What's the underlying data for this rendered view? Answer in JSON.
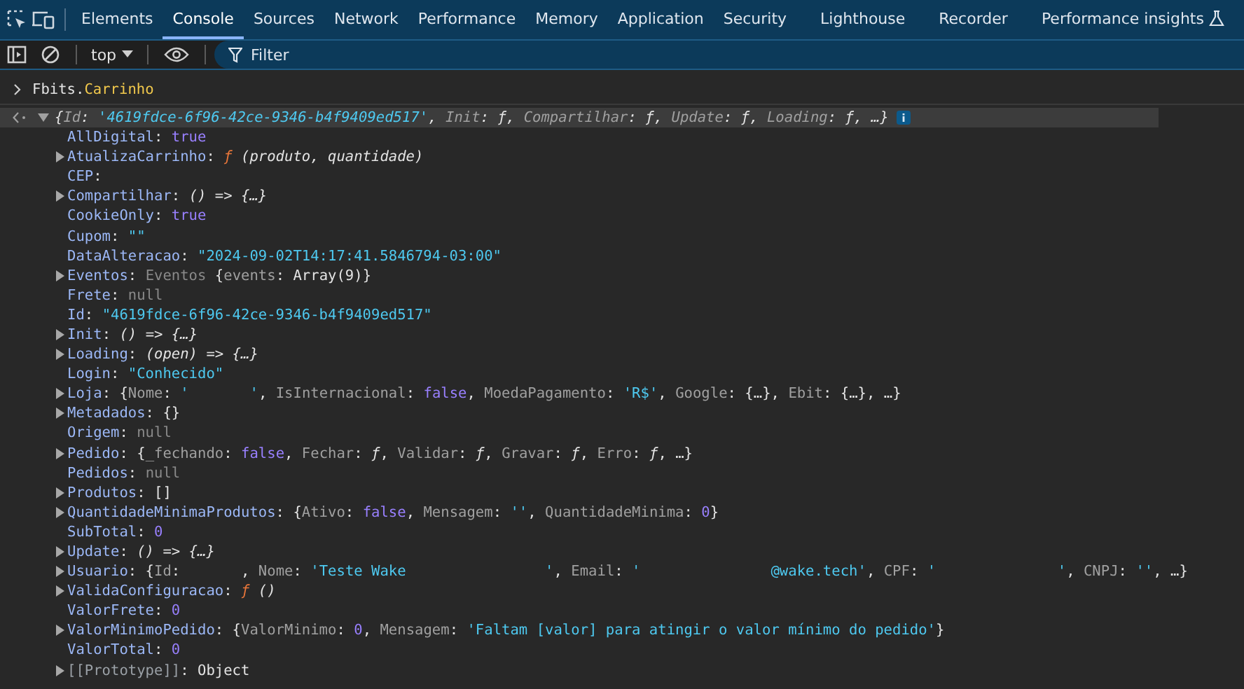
{
  "tabs": [
    {
      "label": "Elements",
      "selected": false
    },
    {
      "label": "Console",
      "selected": true
    },
    {
      "label": "Sources",
      "selected": false
    },
    {
      "label": "Network",
      "selected": false
    },
    {
      "label": "Performance",
      "selected": false
    },
    {
      "label": "Memory",
      "selected": false
    },
    {
      "label": "Application",
      "selected": false
    },
    {
      "label": "Security",
      "selected": false
    },
    {
      "label": "Lighthouse",
      "selected": false
    },
    {
      "label": "Recorder",
      "selected": false
    },
    {
      "label": "Performance insights",
      "selected": false,
      "experimental": true
    }
  ],
  "toolbar": {
    "context": "top",
    "filter": {
      "placeholder": "Filter"
    }
  },
  "console": {
    "input": [
      {
        "kind": "plain",
        "text": "Fbits."
      },
      {
        "kind": "prop",
        "text": "Carrinho"
      }
    ],
    "result": [
      {
        "kind": "punct",
        "text": "{"
      },
      {
        "kind": "pkey",
        "text": "Id"
      },
      {
        "kind": "punct",
        "text": ": "
      },
      {
        "kind": "str",
        "text": "'4619fdce-6f96-42ce-9346-b4f9409ed517'"
      },
      {
        "kind": "punct",
        "text": ", "
      },
      {
        "kind": "pkey",
        "text": "Init"
      },
      {
        "kind": "punct",
        "text": ": "
      },
      {
        "kind": "code",
        "text": "ƒ"
      },
      {
        "kind": "punct",
        "text": ", "
      },
      {
        "kind": "pkey",
        "text": "Compartilhar"
      },
      {
        "kind": "punct",
        "text": ": "
      },
      {
        "kind": "code",
        "text": "ƒ"
      },
      {
        "kind": "punct",
        "text": ", "
      },
      {
        "kind": "pkey",
        "text": "Update"
      },
      {
        "kind": "punct",
        "text": ": "
      },
      {
        "kind": "code",
        "text": "ƒ"
      },
      {
        "kind": "punct",
        "text": ", "
      },
      {
        "kind": "pkey",
        "text": "Loading"
      },
      {
        "kind": "punct",
        "text": ": "
      },
      {
        "kind": "code",
        "text": "ƒ"
      },
      {
        "kind": "punct",
        "text": ", …}"
      }
    ],
    "properties": [
      {
        "expandable": false,
        "segments": [
          {
            "kind": "key",
            "text": "AllDigital"
          },
          {
            "kind": "punct",
            "text": ": "
          },
          {
            "kind": "kw",
            "text": "true"
          }
        ]
      },
      {
        "expandable": true,
        "segments": [
          {
            "kind": "key",
            "text": "AtualizaCarrinho"
          },
          {
            "kind": "punct",
            "text": ": "
          },
          {
            "kind": "fn",
            "text": "ƒ"
          },
          {
            "kind": "code",
            "text": " (produto, quantidade)"
          }
        ]
      },
      {
        "expandable": false,
        "segments": [
          {
            "kind": "key",
            "text": "CEP"
          },
          {
            "kind": "punct",
            "text": ":"
          }
        ]
      },
      {
        "expandable": true,
        "segments": [
          {
            "kind": "key",
            "text": "Compartilhar"
          },
          {
            "kind": "punct",
            "text": ": "
          },
          {
            "kind": "code",
            "text": "() => {…}"
          }
        ]
      },
      {
        "expandable": false,
        "segments": [
          {
            "kind": "key",
            "text": "CookieOnly"
          },
          {
            "kind": "punct",
            "text": ": "
          },
          {
            "kind": "kw",
            "text": "true"
          }
        ]
      },
      {
        "expandable": false,
        "segments": [
          {
            "kind": "key",
            "text": "Cupom"
          },
          {
            "kind": "punct",
            "text": ": "
          },
          {
            "kind": "str",
            "text": "\"\""
          }
        ]
      },
      {
        "expandable": false,
        "segments": [
          {
            "kind": "key",
            "text": "DataAlteracao"
          },
          {
            "kind": "punct",
            "text": ": "
          },
          {
            "kind": "str",
            "text": "\"2024-09-02T14:17:41.5846794-03:00\""
          }
        ]
      },
      {
        "expandable": true,
        "segments": [
          {
            "kind": "key",
            "text": "Eventos"
          },
          {
            "kind": "punct",
            "text": ": "
          },
          {
            "kind": "null",
            "text": "Eventos "
          },
          {
            "kind": "punct",
            "text": "{"
          },
          {
            "kind": "pkey",
            "text": "events"
          },
          {
            "kind": "punct",
            "text": ": Array(9)}"
          }
        ]
      },
      {
        "expandable": false,
        "segments": [
          {
            "kind": "key",
            "text": "Frete"
          },
          {
            "kind": "punct",
            "text": ": "
          },
          {
            "kind": "null",
            "text": "null"
          }
        ]
      },
      {
        "expandable": false,
        "segments": [
          {
            "kind": "key",
            "text": "Id"
          },
          {
            "kind": "punct",
            "text": ": "
          },
          {
            "kind": "str",
            "text": "\"4619fdce-6f96-42ce-9346-b4f9409ed517\""
          }
        ]
      },
      {
        "expandable": true,
        "segments": [
          {
            "kind": "key",
            "text": "Init"
          },
          {
            "kind": "punct",
            "text": ": "
          },
          {
            "kind": "code",
            "text": "() => {…}"
          }
        ]
      },
      {
        "expandable": true,
        "segments": [
          {
            "kind": "key",
            "text": "Loading"
          },
          {
            "kind": "punct",
            "text": ": "
          },
          {
            "kind": "code",
            "text": "(open) => {…}"
          }
        ]
      },
      {
        "expandable": false,
        "segments": [
          {
            "kind": "key",
            "text": "Login"
          },
          {
            "kind": "punct",
            "text": ": "
          },
          {
            "kind": "str",
            "text": "\"Conhecido\""
          }
        ]
      },
      {
        "expandable": true,
        "segments": [
          {
            "kind": "key",
            "text": "Loja"
          },
          {
            "kind": "punct",
            "text": ": {"
          },
          {
            "kind": "pkey",
            "text": "Nome"
          },
          {
            "kind": "punct",
            "text": ": "
          },
          {
            "kind": "str",
            "text": "'       '"
          },
          {
            "kind": "punct",
            "text": ", "
          },
          {
            "kind": "pkey",
            "text": "IsInternacional"
          },
          {
            "kind": "punct",
            "text": ": "
          },
          {
            "kind": "kw",
            "text": "false"
          },
          {
            "kind": "punct",
            "text": ", "
          },
          {
            "kind": "pkey",
            "text": "MoedaPagamento"
          },
          {
            "kind": "punct",
            "text": ": "
          },
          {
            "kind": "str",
            "text": "'R$'"
          },
          {
            "kind": "punct",
            "text": ", "
          },
          {
            "kind": "pkey",
            "text": "Google"
          },
          {
            "kind": "punct",
            "text": ": {…}, "
          },
          {
            "kind": "pkey",
            "text": "Ebit"
          },
          {
            "kind": "punct",
            "text": ": {…}, …}"
          }
        ]
      },
      {
        "expandable": true,
        "segments": [
          {
            "kind": "key",
            "text": "Metadados"
          },
          {
            "kind": "punct",
            "text": ": {}"
          }
        ]
      },
      {
        "expandable": false,
        "segments": [
          {
            "kind": "key",
            "text": "Origem"
          },
          {
            "kind": "punct",
            "text": ": "
          },
          {
            "kind": "null",
            "text": "null"
          }
        ]
      },
      {
        "expandable": true,
        "segments": [
          {
            "kind": "key",
            "text": "Pedido"
          },
          {
            "kind": "punct",
            "text": ": {"
          },
          {
            "kind": "pkey",
            "text": "_fechando"
          },
          {
            "kind": "punct",
            "text": ": "
          },
          {
            "kind": "kw",
            "text": "false"
          },
          {
            "kind": "punct",
            "text": ", "
          },
          {
            "kind": "pkey",
            "text": "Fechar"
          },
          {
            "kind": "punct",
            "text": ": "
          },
          {
            "kind": "code",
            "text": "ƒ"
          },
          {
            "kind": "punct",
            "text": ", "
          },
          {
            "kind": "pkey",
            "text": "Validar"
          },
          {
            "kind": "punct",
            "text": ": "
          },
          {
            "kind": "code",
            "text": "ƒ"
          },
          {
            "kind": "punct",
            "text": ", "
          },
          {
            "kind": "pkey",
            "text": "Gravar"
          },
          {
            "kind": "punct",
            "text": ": "
          },
          {
            "kind": "code",
            "text": "ƒ"
          },
          {
            "kind": "punct",
            "text": ", "
          },
          {
            "kind": "pkey",
            "text": "Erro"
          },
          {
            "kind": "punct",
            "text": ": "
          },
          {
            "kind": "code",
            "text": "ƒ"
          },
          {
            "kind": "punct",
            "text": ", …}"
          }
        ]
      },
      {
        "expandable": false,
        "segments": [
          {
            "kind": "key",
            "text": "Pedidos"
          },
          {
            "kind": "punct",
            "text": ": "
          },
          {
            "kind": "null",
            "text": "null"
          }
        ]
      },
      {
        "expandable": true,
        "segments": [
          {
            "kind": "key",
            "text": "Produtos"
          },
          {
            "kind": "punct",
            "text": ": []"
          }
        ]
      },
      {
        "expandable": true,
        "segments": [
          {
            "kind": "key",
            "text": "QuantidadeMinimaProdutos"
          },
          {
            "kind": "punct",
            "text": ": {"
          },
          {
            "kind": "pkey",
            "text": "Ativo"
          },
          {
            "kind": "punct",
            "text": ": "
          },
          {
            "kind": "kw",
            "text": "false"
          },
          {
            "kind": "punct",
            "text": ", "
          },
          {
            "kind": "pkey",
            "text": "Mensagem"
          },
          {
            "kind": "punct",
            "text": ": "
          },
          {
            "kind": "str",
            "text": "''"
          },
          {
            "kind": "punct",
            "text": ", "
          },
          {
            "kind": "pkey",
            "text": "QuantidadeMinima"
          },
          {
            "kind": "punct",
            "text": ": "
          },
          {
            "kind": "kw",
            "text": "0"
          },
          {
            "kind": "punct",
            "text": "}"
          }
        ]
      },
      {
        "expandable": false,
        "segments": [
          {
            "kind": "key",
            "text": "SubTotal"
          },
          {
            "kind": "punct",
            "text": ": "
          },
          {
            "kind": "kw",
            "text": "0"
          }
        ]
      },
      {
        "expandable": true,
        "segments": [
          {
            "kind": "key",
            "text": "Update"
          },
          {
            "kind": "punct",
            "text": ": "
          },
          {
            "kind": "code",
            "text": "() => {…}"
          }
        ]
      },
      {
        "expandable": true,
        "segments": [
          {
            "kind": "key",
            "text": "Usuario"
          },
          {
            "kind": "punct",
            "text": ": {"
          },
          {
            "kind": "pkey",
            "text": "Id"
          },
          {
            "kind": "punct",
            "text": ":       , "
          },
          {
            "kind": "pkey",
            "text": "Nome"
          },
          {
            "kind": "punct",
            "text": ": "
          },
          {
            "kind": "str",
            "text": "'Teste Wake                '"
          },
          {
            "kind": "punct",
            "text": ", "
          },
          {
            "kind": "pkey",
            "text": "Email"
          },
          {
            "kind": "punct",
            "text": ": "
          },
          {
            "kind": "str",
            "text": "'               @wake.tech'"
          },
          {
            "kind": "punct",
            "text": ", "
          },
          {
            "kind": "pkey",
            "text": "CPF"
          },
          {
            "kind": "punct",
            "text": ": "
          },
          {
            "kind": "str",
            "text": "'              '"
          },
          {
            "kind": "punct",
            "text": ", "
          },
          {
            "kind": "pkey",
            "text": "CNPJ"
          },
          {
            "kind": "punct",
            "text": ": "
          },
          {
            "kind": "str",
            "text": "''"
          },
          {
            "kind": "punct",
            "text": ", …}"
          }
        ]
      },
      {
        "expandable": true,
        "segments": [
          {
            "kind": "key",
            "text": "ValidaConfiguracao"
          },
          {
            "kind": "punct",
            "text": ": "
          },
          {
            "kind": "fn",
            "text": "ƒ"
          },
          {
            "kind": "code",
            "text": " ()"
          }
        ]
      },
      {
        "expandable": false,
        "segments": [
          {
            "kind": "key",
            "text": "ValorFrete"
          },
          {
            "kind": "punct",
            "text": ": "
          },
          {
            "kind": "kw",
            "text": "0"
          }
        ]
      },
      {
        "expandable": true,
        "segments": [
          {
            "kind": "key",
            "text": "ValorMinimoPedido"
          },
          {
            "kind": "punct",
            "text": ": {"
          },
          {
            "kind": "pkey",
            "text": "ValorMinimo"
          },
          {
            "kind": "punct",
            "text": ": "
          },
          {
            "kind": "kw",
            "text": "0"
          },
          {
            "kind": "punct",
            "text": ", "
          },
          {
            "kind": "pkey",
            "text": "Mensagem"
          },
          {
            "kind": "punct",
            "text": ": "
          },
          {
            "kind": "str",
            "text": "'Faltam [valor] para atingir o valor mínimo do pedido'"
          },
          {
            "kind": "punct",
            "text": "}"
          }
        ]
      },
      {
        "expandable": false,
        "segments": [
          {
            "kind": "key",
            "text": "ValorTotal"
          },
          {
            "kind": "punct",
            "text": ": "
          },
          {
            "kind": "kw",
            "text": "0"
          }
        ]
      },
      {
        "expandable": true,
        "segments": [
          {
            "kind": "proto",
            "text": "[[Prototype]]"
          },
          {
            "kind": "punct",
            "text": ": Object"
          }
        ]
      }
    ]
  }
}
